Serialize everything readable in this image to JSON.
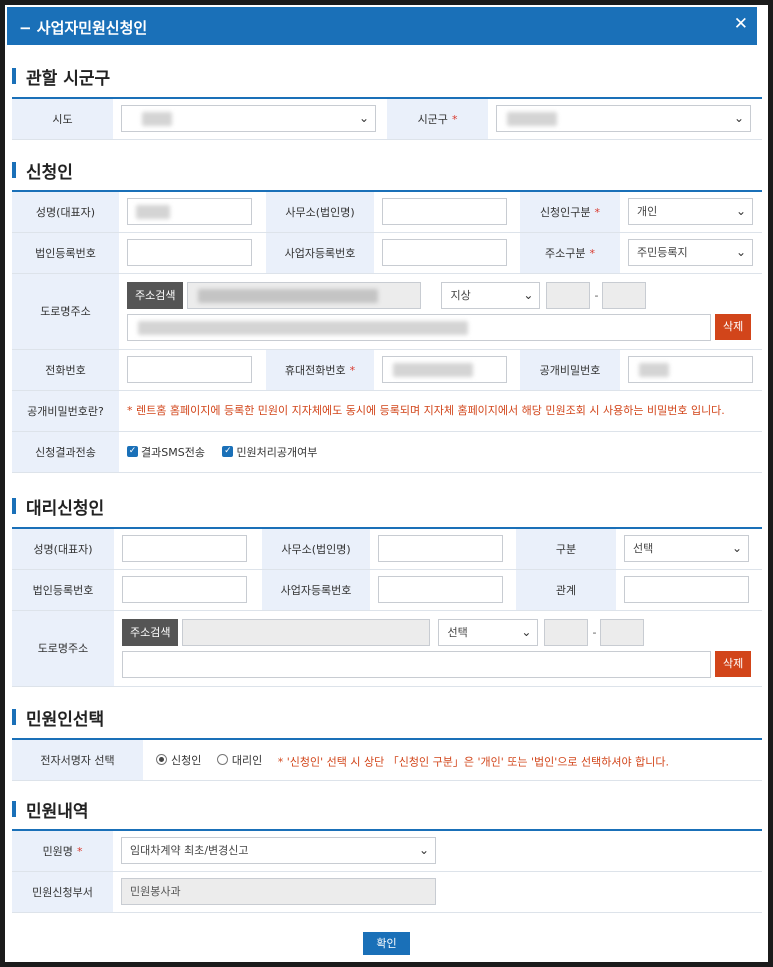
{
  "dialog": {
    "title": "사업자민원신청인",
    "collapse_icon": "minus-icon",
    "close_icon": "close-icon"
  },
  "section_region": {
    "title": "관할 시군구",
    "sido_label": "시도",
    "sigungu_label": "시군구",
    "required_mark": "*"
  },
  "section_applicant": {
    "title": "신청인",
    "name_label": "성명(대표자)",
    "office_label": "사무소(법인명)",
    "type_label": "신청인구분",
    "type_value": "개인",
    "corp_no_label": "법인등록번호",
    "biz_no_label": "사업자등록번호",
    "addr_type_label": "주소구분",
    "addr_type_value": "주민등록지",
    "road_addr_label": "도로명주소",
    "addr_search_btn": "주소검색",
    "floor_value": "지상",
    "delete_btn": "삭제",
    "phone_label": "전화번호",
    "mobile_label": "휴대전화번호",
    "public_pw_label": "공개비밀번호",
    "pw_help_label": "공개비밀번호란?",
    "pw_help_note": "* 렌트홈 홈페이지에 등록한 민원이 지자체에도 동시에 등록되며 지자체 홈페이지에서 해당 민원조회 시 사용하는 비밀번호 입니다.",
    "result_label": "신청결과전송",
    "sms_check": "결과SMS전송",
    "public_check": "민원처리공개여부",
    "required_mark": "*"
  },
  "section_agent": {
    "title": "대리신청인",
    "name_label": "성명(대표자)",
    "office_label": "사무소(법인명)",
    "type_label": "구분",
    "type_value": "선택",
    "corp_no_label": "법인등록번호",
    "biz_no_label": "사업자등록번호",
    "relation_label": "관계",
    "road_addr_label": "도로명주소",
    "addr_search_btn": "주소검색",
    "floor_value": "선택",
    "delete_btn": "삭제"
  },
  "section_select": {
    "title": "민원인선택",
    "signer_label": "전자서명자 선택",
    "radio_applicant": "신청인",
    "radio_agent": "대리인",
    "note": "* '신청인' 선택 시 상단 「신청인 구분」은 '개인' 또는 '법인'으로 선택하셔야 합니다."
  },
  "section_detail": {
    "title": "민원내역",
    "name_label": "민원명",
    "name_value": "임대차계약 최초/변경신고",
    "dept_label": "민원신청부서",
    "dept_value": "민원봉사과",
    "required_mark": "*"
  },
  "confirm_btn": "확인"
}
